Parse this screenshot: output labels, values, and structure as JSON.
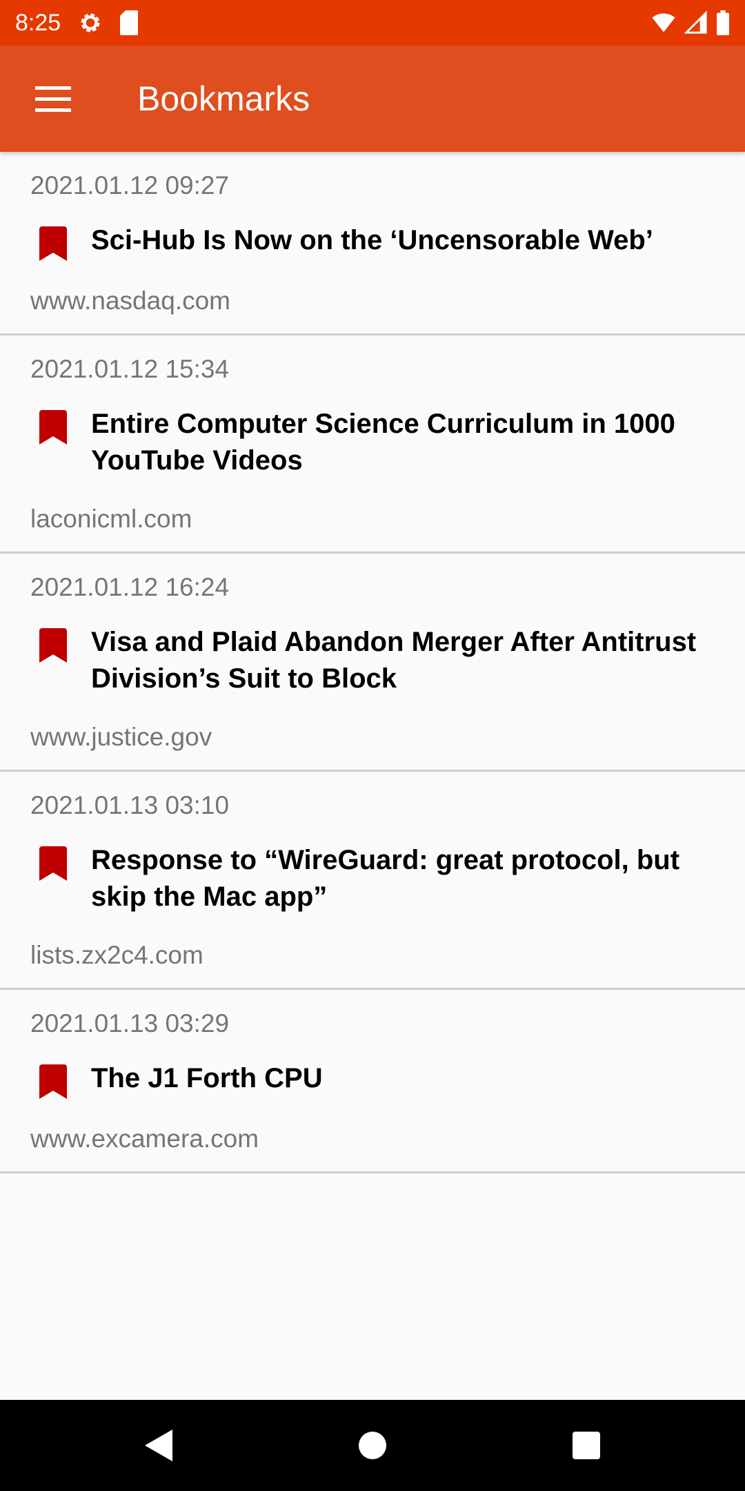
{
  "status_bar": {
    "time": "8:25",
    "icons": [
      "gear-icon",
      "sd-card-icon",
      "wifi-icon",
      "signal-icon",
      "battery-icon"
    ]
  },
  "toolbar": {
    "title": "Bookmarks",
    "menu_icon": "hamburger-menu-icon"
  },
  "colors": {
    "status_bar": "#e63900",
    "toolbar": "#df4e1f",
    "bookmark": "#c00000"
  },
  "bookmarks": [
    {
      "date": "2021.01.12 09:27",
      "title": "Sci-Hub Is Now on the ‘Uncensorable Web’",
      "url": "www.nasdaq.com"
    },
    {
      "date": "2021.01.12 15:34",
      "title": "Entire Computer Science Curriculum in 1000 YouTube Videos",
      "url": "laconicml.com"
    },
    {
      "date": "2021.01.12 16:24",
      "title": "Visa and Plaid Abandon Merger After Antitrust Division’s Suit to Block",
      "url": "www.justice.gov"
    },
    {
      "date": "2021.01.13 03:10",
      "title": "Response to “WireGuard: great protocol, but skip the Mac app”",
      "url": "lists.zx2c4.com"
    },
    {
      "date": "2021.01.13 03:29",
      "title": "The J1 Forth CPU",
      "url": "www.excamera.com"
    }
  ]
}
